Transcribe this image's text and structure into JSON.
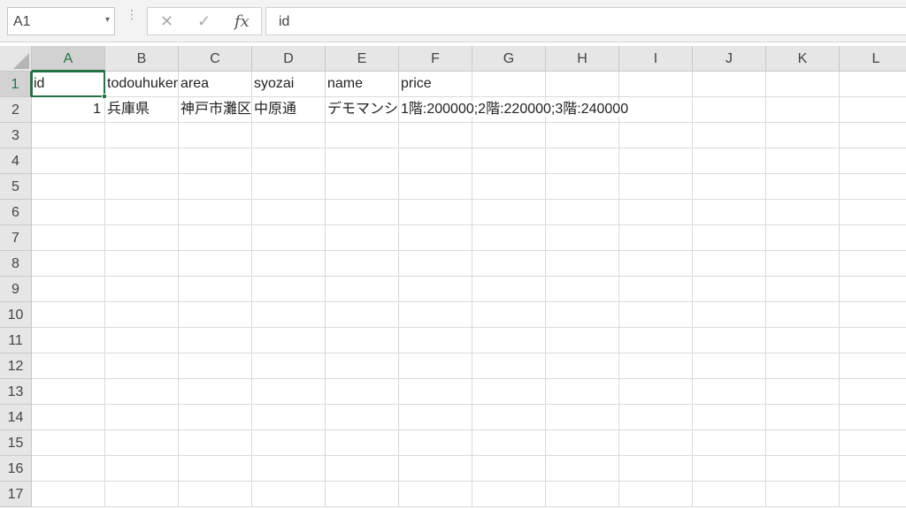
{
  "formula_bar": {
    "name_box": "A1",
    "formula": "id",
    "icons": {
      "cancel": "✕",
      "enter": "✓",
      "function": "fx",
      "name_box_dropdown": "▾",
      "more": "⋮"
    }
  },
  "columns": [
    "A",
    "B",
    "C",
    "D",
    "E",
    "F",
    "G",
    "H",
    "I",
    "J",
    "K",
    "L"
  ],
  "rows": [
    "1",
    "2",
    "3",
    "4",
    "5",
    "6",
    "7",
    "8",
    "9",
    "10",
    "11",
    "12",
    "13",
    "14",
    "15",
    "16",
    "17"
  ],
  "active_cell": "A1",
  "accent_color": "#217346",
  "cells": {
    "A1": "id",
    "B1": "todouhuken",
    "C1": "area",
    "D1": "syozai",
    "E1": "name",
    "F1": "price",
    "A2": "1",
    "B2": "兵庫県",
    "C2": "神戸市灘区",
    "D2": "中原通",
    "E2": "デモマンション",
    "F2": "1階:200000;2階:220000;3階:240000"
  }
}
